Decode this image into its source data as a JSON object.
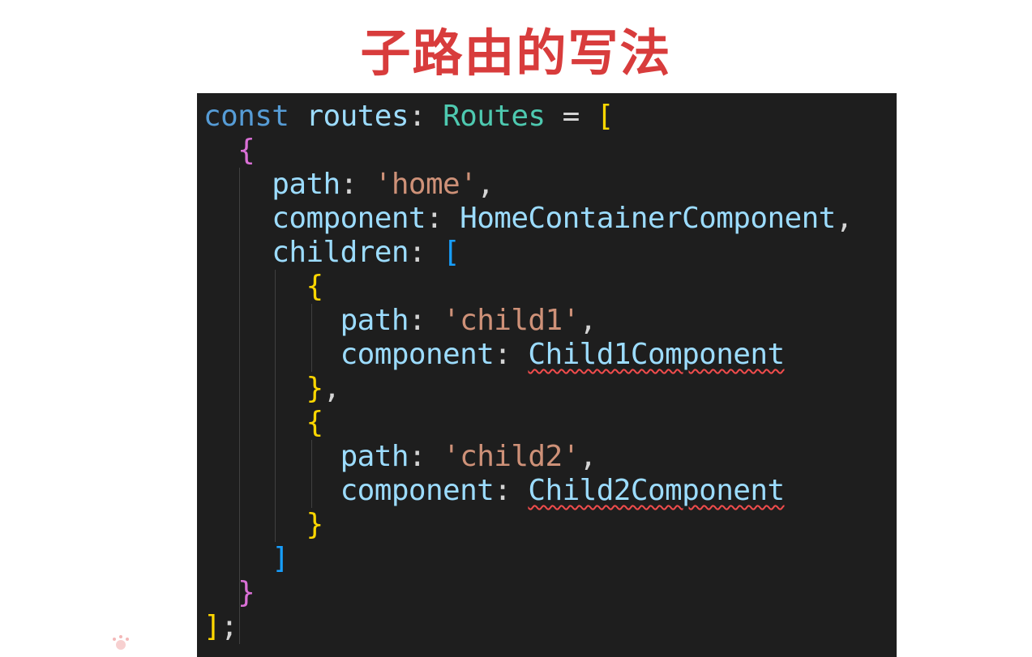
{
  "title": "子路由的写法",
  "code": {
    "language": "typescript",
    "lines": [
      [
        {
          "t": "const",
          "c": "kw"
        },
        {
          "t": " "
        },
        {
          "t": "routes",
          "c": "var"
        },
        {
          "t": ": "
        },
        {
          "t": "Routes",
          "c": "type"
        },
        {
          "t": " = "
        },
        {
          "t": "[",
          "c": "b-gold"
        }
      ],
      [
        {
          "t": "  "
        },
        {
          "t": "{",
          "c": "b-pink"
        }
      ],
      [
        {
          "t": "    "
        },
        {
          "t": "path",
          "c": "var"
        },
        {
          "t": ": "
        },
        {
          "t": "'home'",
          "c": "str"
        },
        {
          "t": ","
        }
      ],
      [
        {
          "t": "    "
        },
        {
          "t": "component",
          "c": "var"
        },
        {
          "t": ": "
        },
        {
          "t": "HomeContainerComponent",
          "c": "var"
        },
        {
          "t": ","
        }
      ],
      [
        {
          "t": "    "
        },
        {
          "t": "children",
          "c": "var"
        },
        {
          "t": ": "
        },
        {
          "t": "[",
          "c": "b-blue"
        }
      ],
      [
        {
          "t": "      "
        },
        {
          "t": "{",
          "c": "b-gold"
        }
      ],
      [
        {
          "t": "        "
        },
        {
          "t": "path",
          "c": "var"
        },
        {
          "t": ": "
        },
        {
          "t": "'child1'",
          "c": "str"
        },
        {
          "t": ","
        }
      ],
      [
        {
          "t": "        "
        },
        {
          "t": "component",
          "c": "var"
        },
        {
          "t": ": "
        },
        {
          "t": "Child1Component",
          "c": "var",
          "err": true
        }
      ],
      [
        {
          "t": "      "
        },
        {
          "t": "}",
          "c": "b-gold"
        },
        {
          "t": ","
        }
      ],
      [
        {
          "t": "      "
        },
        {
          "t": "{",
          "c": "b-gold"
        }
      ],
      [
        {
          "t": "        "
        },
        {
          "t": "path",
          "c": "var"
        },
        {
          "t": ": "
        },
        {
          "t": "'child2'",
          "c": "str"
        },
        {
          "t": ","
        }
      ],
      [
        {
          "t": "        "
        },
        {
          "t": "component",
          "c": "var"
        },
        {
          "t": ": "
        },
        {
          "t": "Child2Component",
          "c": "var",
          "err": true
        }
      ],
      [
        {
          "t": "      "
        },
        {
          "t": "}",
          "c": "b-gold"
        }
      ],
      [
        {
          "t": "    "
        },
        {
          "t": "]",
          "c": "b-blue"
        }
      ],
      [
        {
          "t": "  "
        },
        {
          "t": "}",
          "c": "b-pink"
        }
      ],
      [
        {
          "t": "]",
          "c": "b-gold"
        },
        {
          "t": ";"
        }
      ]
    ]
  },
  "colors": {
    "title": "#d83c3c",
    "editor_background": "#1e1e1e",
    "keyword": "#569cd6",
    "variable": "#9cdcfe",
    "type": "#4ec9b0",
    "string": "#ce9178",
    "error_underline": "#f14c4c"
  }
}
